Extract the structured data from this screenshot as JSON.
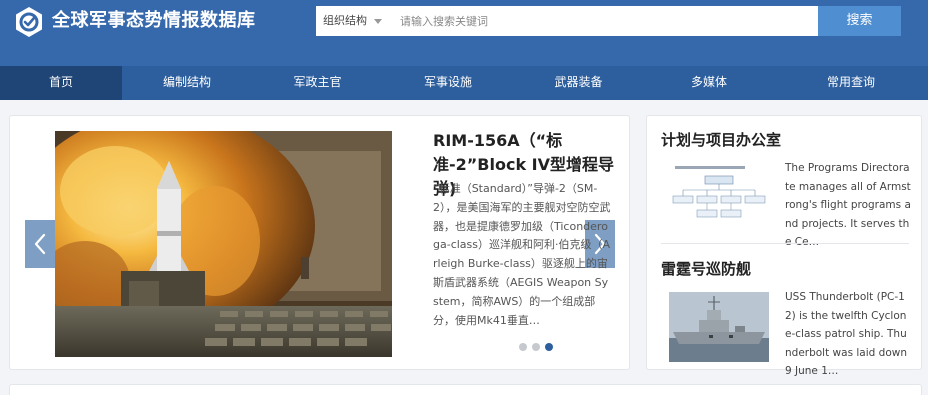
{
  "header": {
    "site_title": "全球军事态势情报数据库",
    "search_category": "组织结构",
    "search_placeholder": "请输入搜索关键词",
    "search_button": "搜索"
  },
  "nav": {
    "items": [
      "首页",
      "编制结构",
      "军政主官",
      "军事设施",
      "武器装备",
      "多媒体",
      "常用查询"
    ],
    "active_index": 0
  },
  "featured": {
    "title": "RIM-156A（“标准-2”Block IV型增程导弹)",
    "description": "“标准（Standard）”导弹-2（SM-2），是美国海军的主要舰对空防空武器，也是提康德罗加级（Ticonderoga-class）巡洋舰和阿利·伯克级（Arleigh Burke-class）驱逐舰上的宙斯盾武器系统（AEGIS Weapon System，简称AWS）的一个组成部分，使用Mk41垂直…",
    "slide_count": 3,
    "active_slide": 3
  },
  "side": {
    "items": [
      {
        "heading": "计划与项目办公室",
        "text": "The Programs Directorate manages all of Armstrong's flight programs and projects. It serves the Ce…"
      },
      {
        "heading": "雷霆号巡防舰",
        "text": "USS Thunderbolt (PC-12) is the twelfth Cyclone-class patrol ship. Thunderbolt was laid down 9 June 1…"
      }
    ]
  },
  "colors": {
    "header_bg": "#3668ac",
    "nav_bg": "#2d5f9e",
    "nav_active_bg": "#1f4476",
    "search_button_bg": "#4f8ed0",
    "dot_active": "#2d5f9e"
  }
}
